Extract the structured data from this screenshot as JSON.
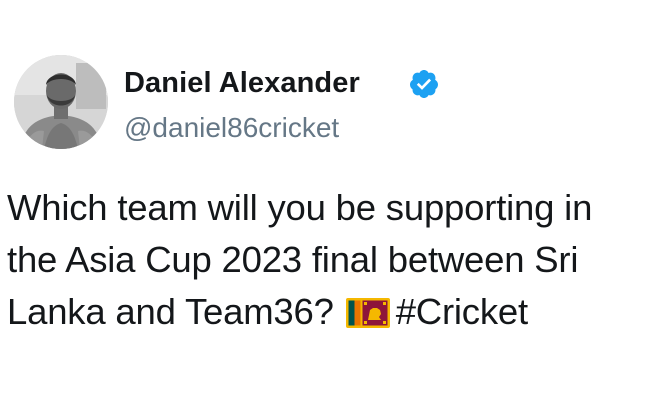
{
  "author": {
    "display_name": "Daniel Alexander",
    "handle": "@daniel86cricket",
    "verified": true,
    "verified_icon": "verified-badge-icon",
    "verified_color": "#1da1f2",
    "avatar": "profile-photo"
  },
  "tweet": {
    "line1": "Which team will you be supporting in",
    "line2": "the Asia Cup 2023 final between Sri",
    "line3_before_emoji": "Lanka and Team36?",
    "emoji": "sri-lanka-flag-emoji",
    "hashtag": "#Cricket"
  },
  "colors": {
    "text": "#14171a",
    "handle": "#657786",
    "background": "#ffffff"
  }
}
